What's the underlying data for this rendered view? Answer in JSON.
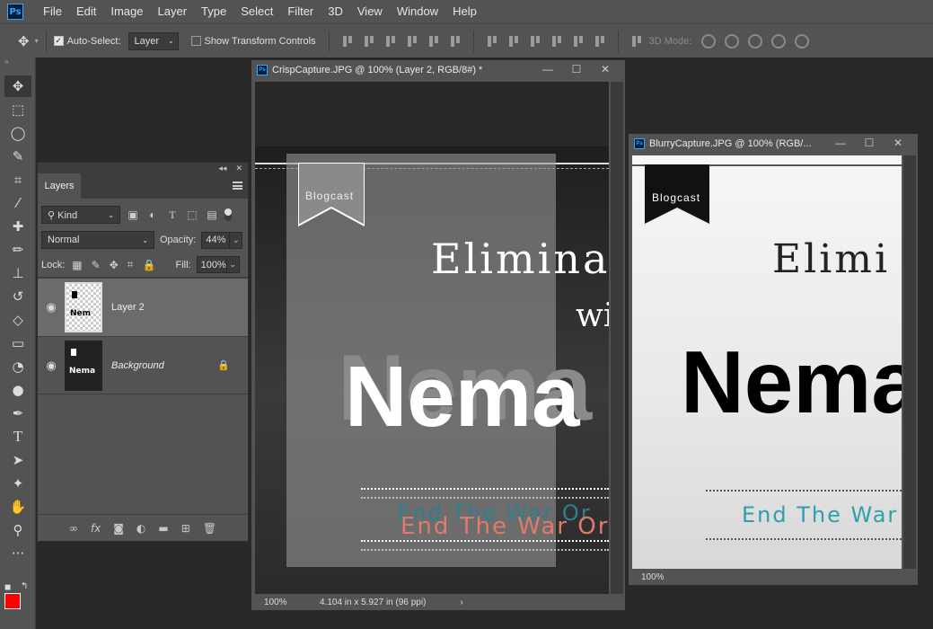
{
  "menubar": {
    "logo": "Ps",
    "items": [
      "File",
      "Edit",
      "Image",
      "Layer",
      "Type",
      "Select",
      "Filter",
      "3D",
      "View",
      "Window",
      "Help"
    ]
  },
  "options": {
    "auto_select_label": "Auto-Select:",
    "auto_select_value": "Layer",
    "show_transform_label": "Show Transform Controls",
    "mode_3d_label": "3D Mode:"
  },
  "toolbar": {
    "tools": [
      "move-tool",
      "marquee-tool",
      "lasso-tool",
      "quick-select-tool",
      "crop-tool",
      "eyedropper-tool",
      "healing-brush-tool",
      "brush-tool",
      "clone-stamp-tool",
      "history-brush-tool",
      "eraser-tool",
      "gradient-tool",
      "blur-tool",
      "dodge-tool",
      "pen-tool",
      "type-tool",
      "path-select-tool",
      "shape-tool",
      "hand-tool",
      "zoom-tool",
      "more-tools"
    ],
    "foreground_color": "#ff0000",
    "background_color": "#ffffff"
  },
  "layers_panel": {
    "tab_label": "Layers",
    "filter_kind": "Kind",
    "blend_mode": "Normal",
    "opacity_label": "Opacity:",
    "opacity_value": "44%",
    "lock_label": "Lock:",
    "fill_label": "Fill:",
    "fill_value": "100%",
    "layers": [
      {
        "name": "Layer 2",
        "selected": true,
        "thumb_text": "Nem"
      },
      {
        "name": "Background",
        "selected": false,
        "thumb_text": "Nema",
        "locked": true
      }
    ]
  },
  "doc1": {
    "title": "CrispCapture.JPG @ 100% (Layer 2, RGB/8#) *",
    "zoom": "100%",
    "doc_info": "4.104 in x 5.927 in (96 ppi)",
    "banner_text": "Blogcast",
    "headline": "Elimina",
    "headline2": "wi",
    "bigname": "Nema",
    "tagline": "End The War Or",
    "tagline_color": "#e07a6a"
  },
  "doc2": {
    "title": "BlurryCapture.JPG @ 100% (RGB/...",
    "zoom": "100%",
    "banner_text": "Blogcast",
    "headline": "Elimi",
    "bigname": "Nema",
    "tagline": "End The War",
    "tagline_color": "#2f9fae"
  }
}
